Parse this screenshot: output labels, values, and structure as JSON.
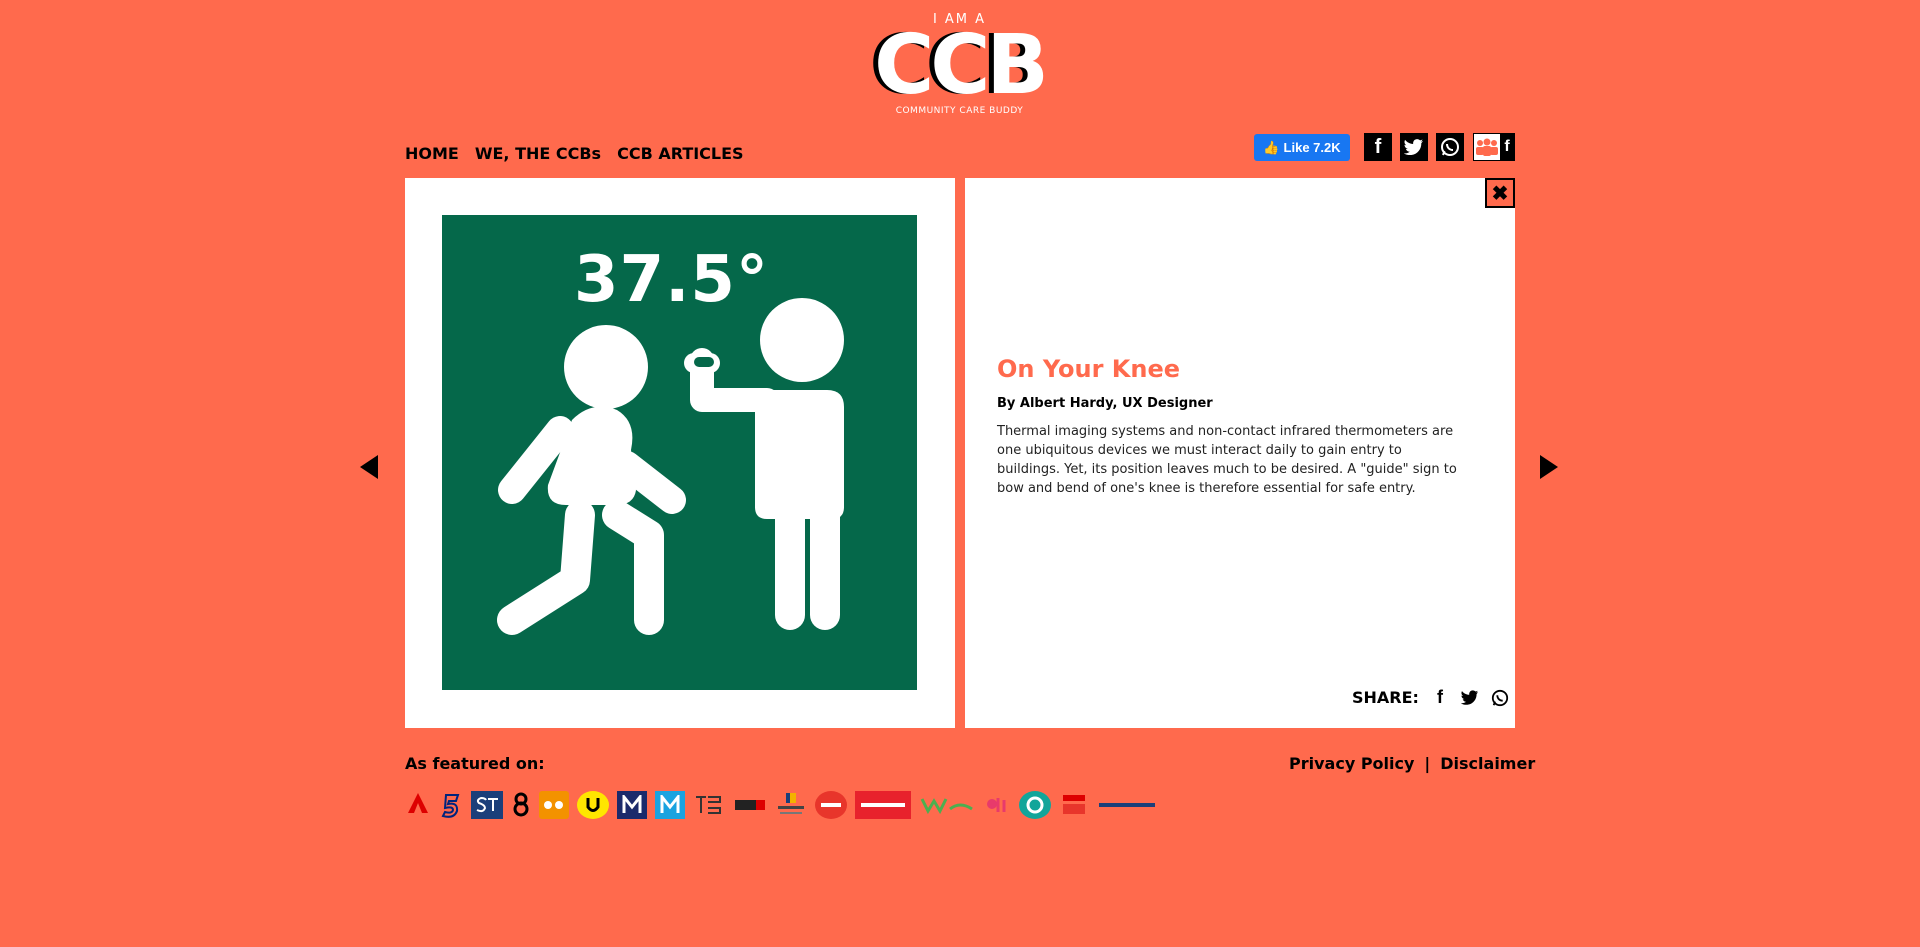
{
  "logo": {
    "pre": "I AM A",
    "main": "CCB",
    "sub": "COMMUNITY CARE BUDDY"
  },
  "nav": {
    "home": "HOME",
    "we": "WE, THE CCBs",
    "articles": "CCB ARTICLES"
  },
  "social": {
    "fb_like": "Like 7.2K"
  },
  "illustration": {
    "temperature": "37.5°"
  },
  "article": {
    "title": "On Your Knee",
    "byline": "By Albert Hardy, UX Designer",
    "body": "Thermal imaging systems and non-contact infrared thermometers are one ubiquitous devices we must interact daily to gain entry to buildings. Yet, its position leaves much to be desired. A \"guide\" sign to bow and bend of one's knee is therefore essential for safe entry.",
    "share_label": "SHARE:"
  },
  "footer": {
    "featured_label": "As featured on:",
    "privacy": "Privacy Policy",
    "separator": "|",
    "disclaimer": "Disclaimer"
  },
  "colors": {
    "background": "#FF6A4D",
    "sign_green": "#05684A",
    "fb_blue": "#1877F2"
  }
}
